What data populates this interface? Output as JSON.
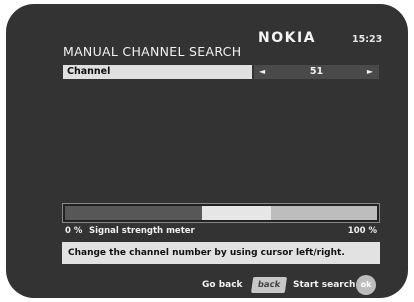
{
  "header": {
    "title": "MANUAL CHANNEL SEARCH",
    "brand": "NOKIA",
    "time": "15:23"
  },
  "channel": {
    "label": "Channel",
    "value": "51",
    "left_arrow_icon": "chevron-left-icon",
    "right_arrow_icon": "chevron-right-icon"
  },
  "meter": {
    "min_label": "0 %",
    "name": "Signal strength meter",
    "max_label": "100 %",
    "level_dark_fraction": 0.44,
    "level_light_fraction": 0.22
  },
  "hint": "Change the channel number by using cursor left/right.",
  "footer": {
    "go_back_label": "Go back",
    "back_key_label": "back",
    "start_search_label": "Start search",
    "ok_key_label": "ok"
  }
}
